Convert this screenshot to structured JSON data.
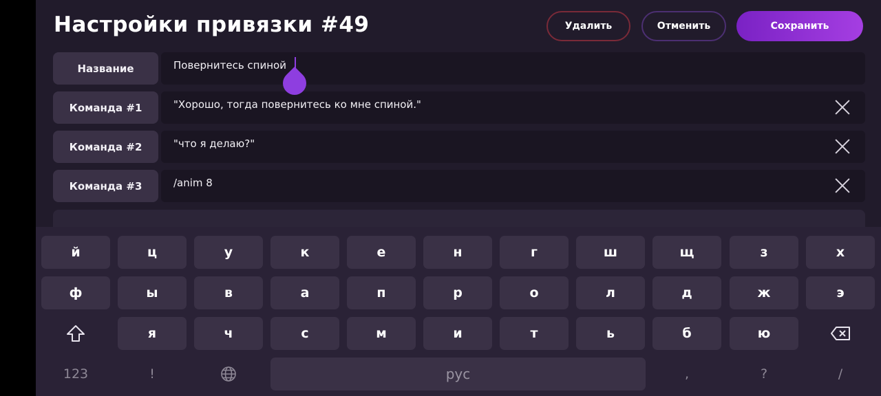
{
  "header": {
    "title": "Настройки привязки #49",
    "delete_label": "Удалить",
    "cancel_label": "Отменить",
    "save_label": "Сохранить"
  },
  "rows": [
    {
      "label": "Название",
      "value": "Повернитесь спиной"
    },
    {
      "label": "Команда #1",
      "value": "\"Хорошо, тогда повернитесь ко мне спиной.\""
    },
    {
      "label": "Команда #2",
      "value": "\"что я делаю?\""
    },
    {
      "label": "Команда #3",
      "value": "/anim 8"
    }
  ],
  "keyboard": {
    "row1": [
      "й",
      "ц",
      "у",
      "к",
      "е",
      "н",
      "г",
      "ш",
      "щ",
      "з",
      "х"
    ],
    "row2": [
      "ф",
      "ы",
      "в",
      "а",
      "п",
      "р",
      "о",
      "л",
      "д",
      "ж",
      "э"
    ],
    "row3": [
      "я",
      "ч",
      "с",
      "м",
      "и",
      "т",
      "ь",
      "б",
      "ю"
    ],
    "numbers_label": "123",
    "exclaim_label": "!",
    "space_label": "рус",
    "comma_label": ",",
    "question_label": "?",
    "slash_label": "/",
    "icons": {
      "shift": "shift-icon",
      "backspace": "backspace-icon",
      "language": "globe-icon"
    }
  },
  "colors": {
    "accent": "#8e3ee0",
    "save_gradient_start": "#7a22c4",
    "save_gradient_end": "#a53ee2",
    "delete_border": "#7a2a38",
    "cancel_border": "#4c2f72"
  }
}
